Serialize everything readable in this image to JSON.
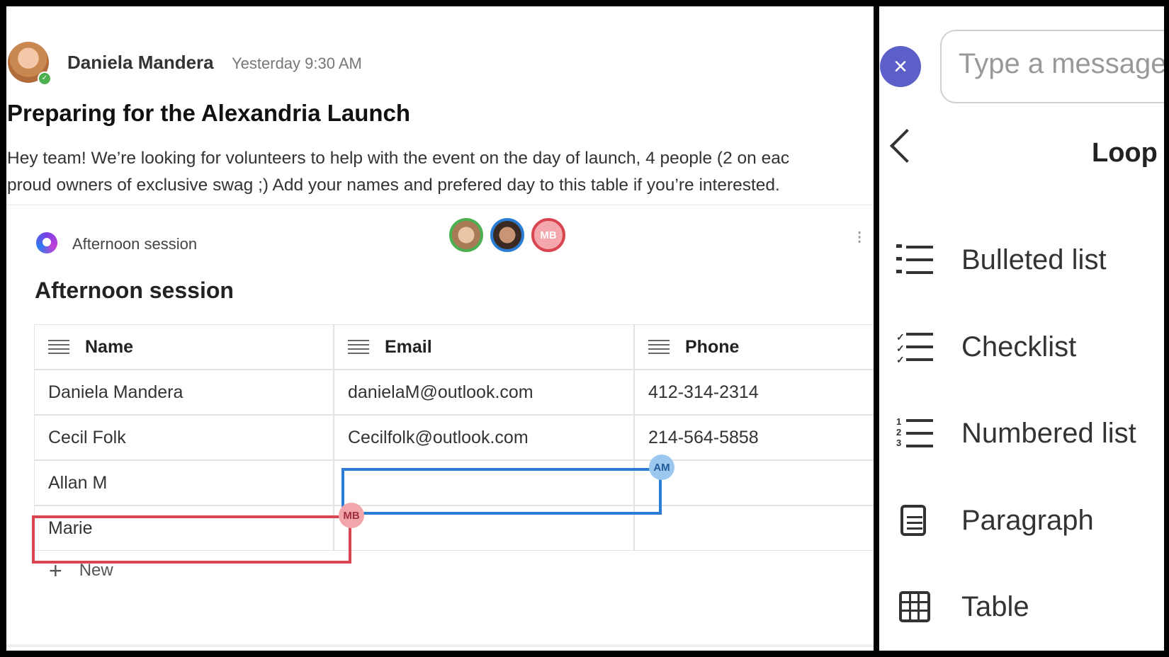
{
  "post": {
    "author": "Daniela Mandera",
    "time": "Yesterday 9:30 AM",
    "title": "Preparing for the Alexandria Launch",
    "body_line1": "Hey team! We’re looking for volunteers to help with the event on the day of launch, 4 people (2 on eac",
    "body_line2": "proud owners of exclusive swag ;) Add your names and prefered day to this table if you’re interested."
  },
  "card": {
    "label": "Afternoon session",
    "section_title": "Afternoon session",
    "collaborators": [
      "",
      "",
      "MB"
    ],
    "columns": [
      "Name",
      "Email",
      "Phone"
    ],
    "rows": [
      [
        "Daniela Mandera",
        "danielaM@outlook.com",
        "412-314-2314"
      ],
      [
        "Cecil Folk",
        "Cecilfolk@outlook.com",
        "214-564-5858"
      ],
      [
        "Allan M",
        "",
        ""
      ],
      [
        "Marie",
        "",
        ""
      ]
    ],
    "cursor_tags": {
      "blue": "AM",
      "red": "MB"
    },
    "new_label": "New",
    "new_icon": "+"
  },
  "panel": {
    "close_icon": "×",
    "message_placeholder": "Type a message",
    "title": "Loop",
    "menu": [
      {
        "label": "Bulleted list",
        "icon": "bulleted-list-icon"
      },
      {
        "label": "Checklist",
        "icon": "checklist-icon"
      },
      {
        "label": "Numbered list",
        "icon": "numbered-list-icon"
      },
      {
        "label": "Paragraph",
        "icon": "paragraph-icon"
      },
      {
        "label": "Table",
        "icon": "table-icon"
      }
    ]
  },
  "colors": {
    "accent": "#5b5fc7",
    "blue_cursor": "#2b7cd3",
    "red_cursor": "#d9454f",
    "presence": "#4caf50"
  }
}
